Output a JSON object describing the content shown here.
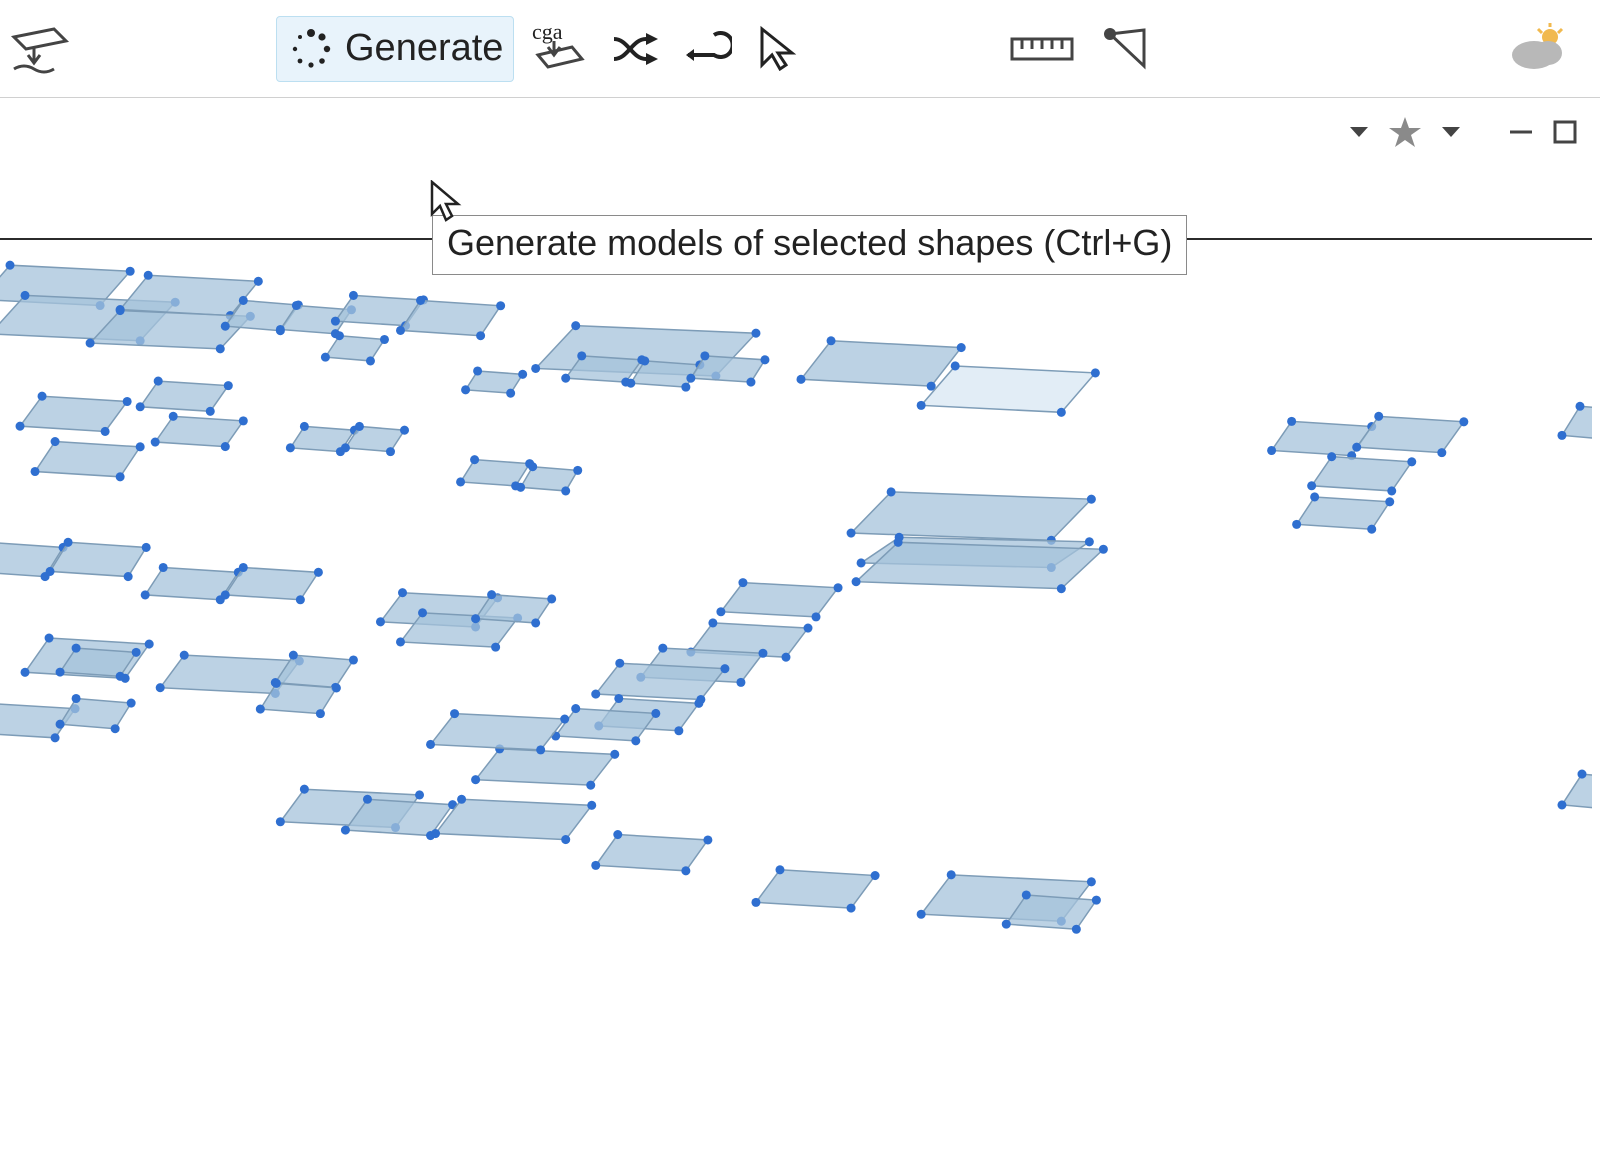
{
  "toolbar": {
    "create_shape_icon": "create-shape-icon",
    "generate_label": "Generate",
    "generate_tooltip": "Generate models of selected shapes (Ctrl+G)",
    "assign_cga_icon_label": "cga"
  },
  "colors": {
    "shape_fill": "#a6c3db",
    "shape_stroke": "#7d9cb7",
    "vertex": "#2f6fd0",
    "tb_icon_stroke": "#444444",
    "star_fill": "#8a8a8a",
    "cloud_fill": "#b8b8b8",
    "sun_fill": "#f1b94e"
  }
}
